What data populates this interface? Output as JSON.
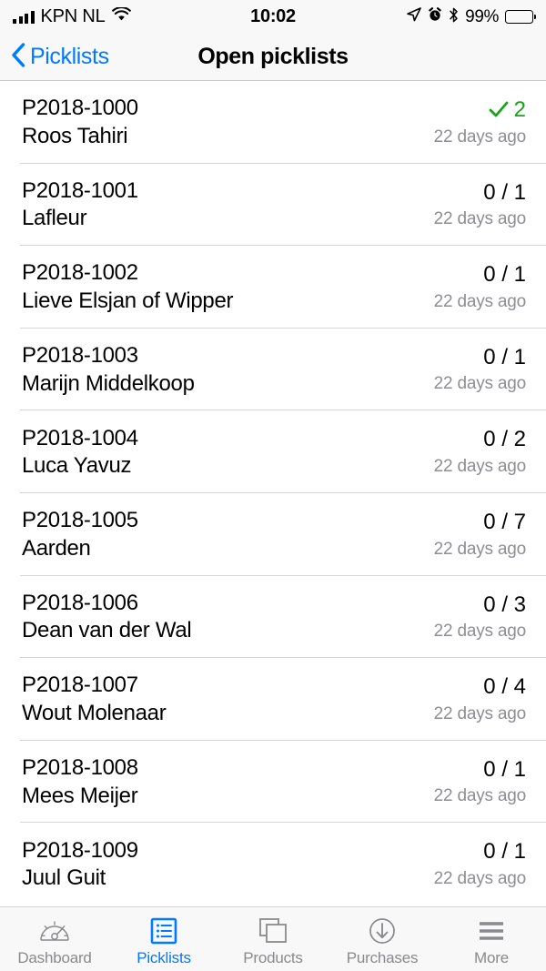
{
  "status_bar": {
    "carrier": "KPN NL",
    "time": "10:02",
    "battery_percent": "99%",
    "icons": [
      "signal-bars-icon",
      "wifi-icon",
      "location-arrow-icon",
      "alarm-clock-icon",
      "bluetooth-icon",
      "battery-icon"
    ]
  },
  "nav_bar": {
    "back_label": "Picklists",
    "back_icon": "chevron-left-icon",
    "title": "Open picklists",
    "accent_color": "#007aff"
  },
  "colors": {
    "accent": "#007aff",
    "done_green": "#19a319",
    "secondary_text": "#8e8e93",
    "separator": "#d6d6d6"
  },
  "list": {
    "items": [
      {
        "code": "P2018-1000",
        "name": "Roos Tahiri",
        "count": "2",
        "done": true,
        "check_icon": "check-icon",
        "time": "22 days ago"
      },
      {
        "code": "P2018-1001",
        "name": "Lafleur",
        "count": "0 / 1",
        "done": false,
        "time": "22 days ago"
      },
      {
        "code": "P2018-1002",
        "name": "Lieve Elsjan of Wipper",
        "count": "0 / 1",
        "done": false,
        "time": "22 days ago"
      },
      {
        "code": "P2018-1003",
        "name": "Marijn Middelkoop",
        "count": "0 / 1",
        "done": false,
        "time": "22 days ago"
      },
      {
        "code": "P2018-1004",
        "name": "Luca Yavuz",
        "count": "0 / 2",
        "done": false,
        "time": "22 days ago"
      },
      {
        "code": "P2018-1005",
        "name": "Aarden",
        "count": "0 / 7",
        "done": false,
        "time": "22 days ago"
      },
      {
        "code": "P2018-1006",
        "name": "Dean van der Wal",
        "count": "0 / 3",
        "done": false,
        "time": "22 days ago"
      },
      {
        "code": "P2018-1007",
        "name": "Wout Molenaar",
        "count": "0 / 4",
        "done": false,
        "time": "22 days ago"
      },
      {
        "code": "P2018-1008",
        "name": "Mees Meijer",
        "count": "0 / 1",
        "done": false,
        "time": "22 days ago"
      },
      {
        "code": "P2018-1009",
        "name": "Juul Guit",
        "count": "0 / 1",
        "done": false,
        "time": "22 days ago"
      }
    ]
  },
  "tab_bar": {
    "active_index": 1,
    "tabs": [
      {
        "label": "Dashboard",
        "icon": "gauge-icon"
      },
      {
        "label": "Picklists",
        "icon": "list-document-icon"
      },
      {
        "label": "Products",
        "icon": "stacked-boxes-icon"
      },
      {
        "label": "Purchases",
        "icon": "download-circle-icon"
      },
      {
        "label": "More",
        "icon": "hamburger-icon"
      }
    ]
  }
}
